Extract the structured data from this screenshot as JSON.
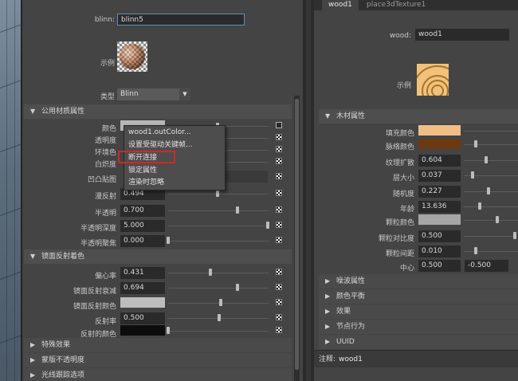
{
  "left_panel": {
    "name_label": "blinn:",
    "name_value": "blinn5",
    "sample_label": "示例",
    "type_label": "类型",
    "type_value": "Blinn",
    "common_section": "公用材质属性",
    "rows": [
      {
        "label": "颜色"
      },
      {
        "label": "透明度"
      },
      {
        "label": "环境色"
      },
      {
        "label": "白炽度"
      },
      {
        "label": "凹凸贴图"
      },
      {
        "label": "漫反射",
        "value": "0.494"
      },
      {
        "label": "半透明",
        "value": "0.700"
      },
      {
        "label": "半透明深度",
        "value": "5.000"
      },
      {
        "label": "半透明聚焦",
        "value": "0.000"
      }
    ],
    "spec_section": "镜面反射着色",
    "spec_rows": [
      {
        "label": "偏心率",
        "value": "0.431"
      },
      {
        "label": "镜面反射衰减",
        "value": "0.694"
      },
      {
        "label": "镜面反射颜色"
      },
      {
        "label": "反射率",
        "value": "0.500"
      },
      {
        "label": "反射的颜色"
      }
    ],
    "collapsed_sections": [
      "特殊效果",
      "蒙版不透明度",
      "光线跟踪选项"
    ],
    "context_menu": {
      "items": [
        "wood1.outColor...",
        "设置受驱动关键帧...",
        "断开连接",
        "锁定属性",
        "渲染时忽略"
      ],
      "highlighted": "断开连接"
    }
  },
  "right_panel": {
    "tabs": [
      "wood1",
      "place3dTexture1"
    ],
    "name_label": "wood:",
    "name_value": "wood1",
    "sample_label": "示例",
    "wood_section": "木材属性",
    "rows": [
      {
        "label": "填充颜色",
        "color": "#f1be86"
      },
      {
        "label": "脉络颜色",
        "color": "#6b3a12"
      },
      {
        "label": "纹理扩散",
        "value": "0.604"
      },
      {
        "label": "层大小",
        "value": "0.037"
      },
      {
        "label": "随机度",
        "value": "0.227"
      },
      {
        "label": "年龄",
        "value": "13.636"
      },
      {
        "label": "颗粒颜色",
        "color": "#a6a6a6"
      },
      {
        "label": "颗粒对比度",
        "value": "0.500"
      },
      {
        "label": "颗粒间距",
        "value": "0.010"
      },
      {
        "label": "中心",
        "value": "0.500",
        "value2": "-0.500"
      }
    ],
    "collapsed_sections": [
      "噪波属性",
      "颜色平衡",
      "效果",
      "节点行为",
      "UUID"
    ],
    "footer_label": "注释:",
    "footer_value": "wood1"
  }
}
